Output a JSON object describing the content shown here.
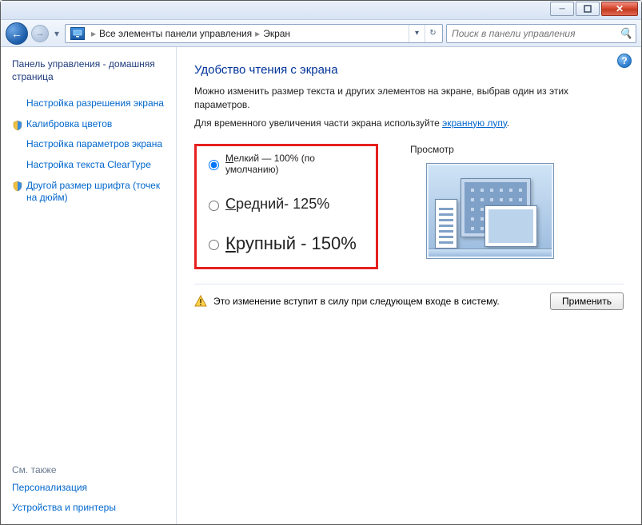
{
  "titlebar": {
    "minimize": "–",
    "maximize": "□",
    "close": "×"
  },
  "nav": {
    "breadcrumb_root": "Все элементы панели управления",
    "breadcrumb_leaf": "Экран",
    "search_placeholder": "Поиск в панели управления"
  },
  "sidebar": {
    "home": "Панель управления - домашняя страница",
    "links": [
      "Настройка разрешения экрана",
      "Калибровка цветов",
      "Настройка параметров экрана",
      "Настройка текста ClearType",
      "Другой размер шрифта (точек на дюйм)"
    ],
    "see_also_head": "См. также",
    "see_also": [
      "Персонализация",
      "Устройства и принтеры"
    ]
  },
  "main": {
    "help": "?",
    "heading": "Удобство чтения с экрана",
    "desc_line1": "Можно изменить размер текста и других элементов на экране, выбрав один из этих параметров.",
    "desc_line2_pre": "Для временного увеличения части экрана используйте ",
    "desc_line2_link": "экранную лупу",
    "desc_line2_post": ".",
    "options": {
      "small_pre": "М",
      "small_post": "елкий — 100% (по умолчанию)",
      "medium_pre": "С",
      "medium_post": "редний- 125%",
      "large_pre": "К",
      "large_post": "рупный - 150%"
    },
    "preview_label": "Просмотр",
    "notice": "Это изменение вступит в силу при следующем входе в систему.",
    "apply": "Применить"
  }
}
